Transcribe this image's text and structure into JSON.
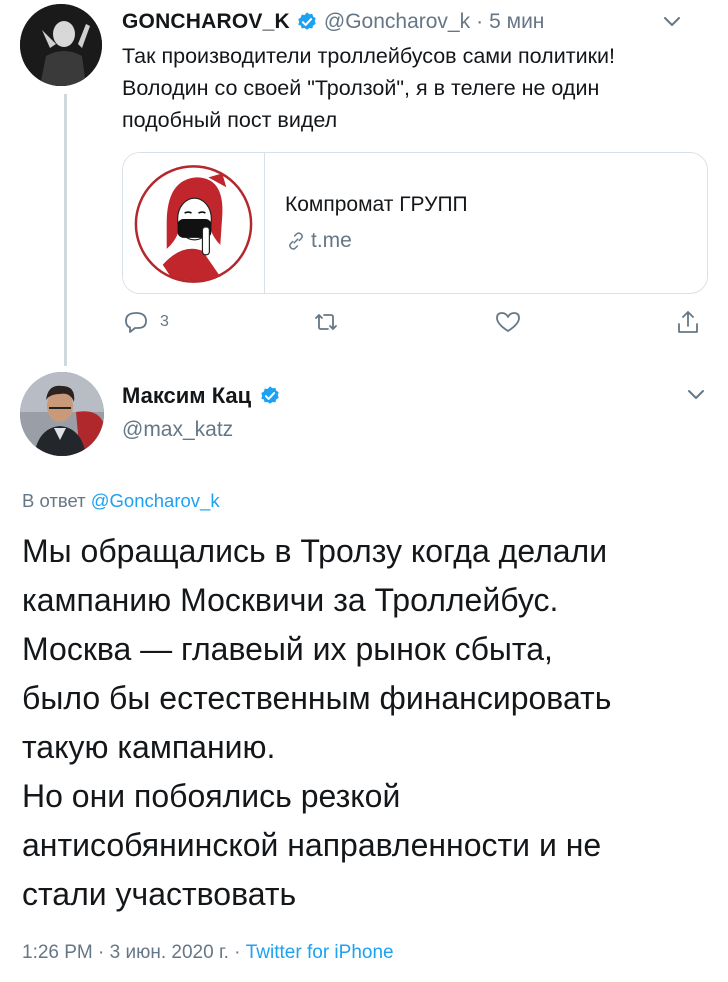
{
  "tweet1": {
    "name": "GONCHAROV_K",
    "handle": "@Goncharov_k",
    "separator": "·",
    "time": "5 мин",
    "text": "Так производители троллейбусов сами политики! Володин со своей \"Тролзой\", я в телеге не один подобный пост видел",
    "card": {
      "title": "Компромат ГРУПП",
      "domain": "t.me"
    },
    "reply_count": "3"
  },
  "tweet2": {
    "name": "Максим Кац",
    "handle": "@max_katz",
    "reply_prefix": "В ответ",
    "reply_handle": "@Goncharov_k",
    "lines": [
      "Мы обращались в Тролзу когда делали",
      "кампанию Москвичи за Троллейбус.",
      "Москва — главеый их рынок сбыта,",
      "было бы естественным финансировать",
      "такую кампанию.",
      "Но они побоялись резкой",
      "антисобянинской направленности и не",
      "стали участвовать"
    ],
    "time": "1:26 PM",
    "date": "3 июн. 2020 г.",
    "separator": "·",
    "source": "Twitter for iPhone"
  },
  "colors": {
    "link": "#1da1f2",
    "muted": "#657786",
    "text": "#14171a",
    "verified": "#1da1f2"
  },
  "icons": [
    "chevron-down-icon",
    "verified-icon",
    "link-icon",
    "reply-icon",
    "retweet-icon",
    "like-icon",
    "share-icon"
  ]
}
